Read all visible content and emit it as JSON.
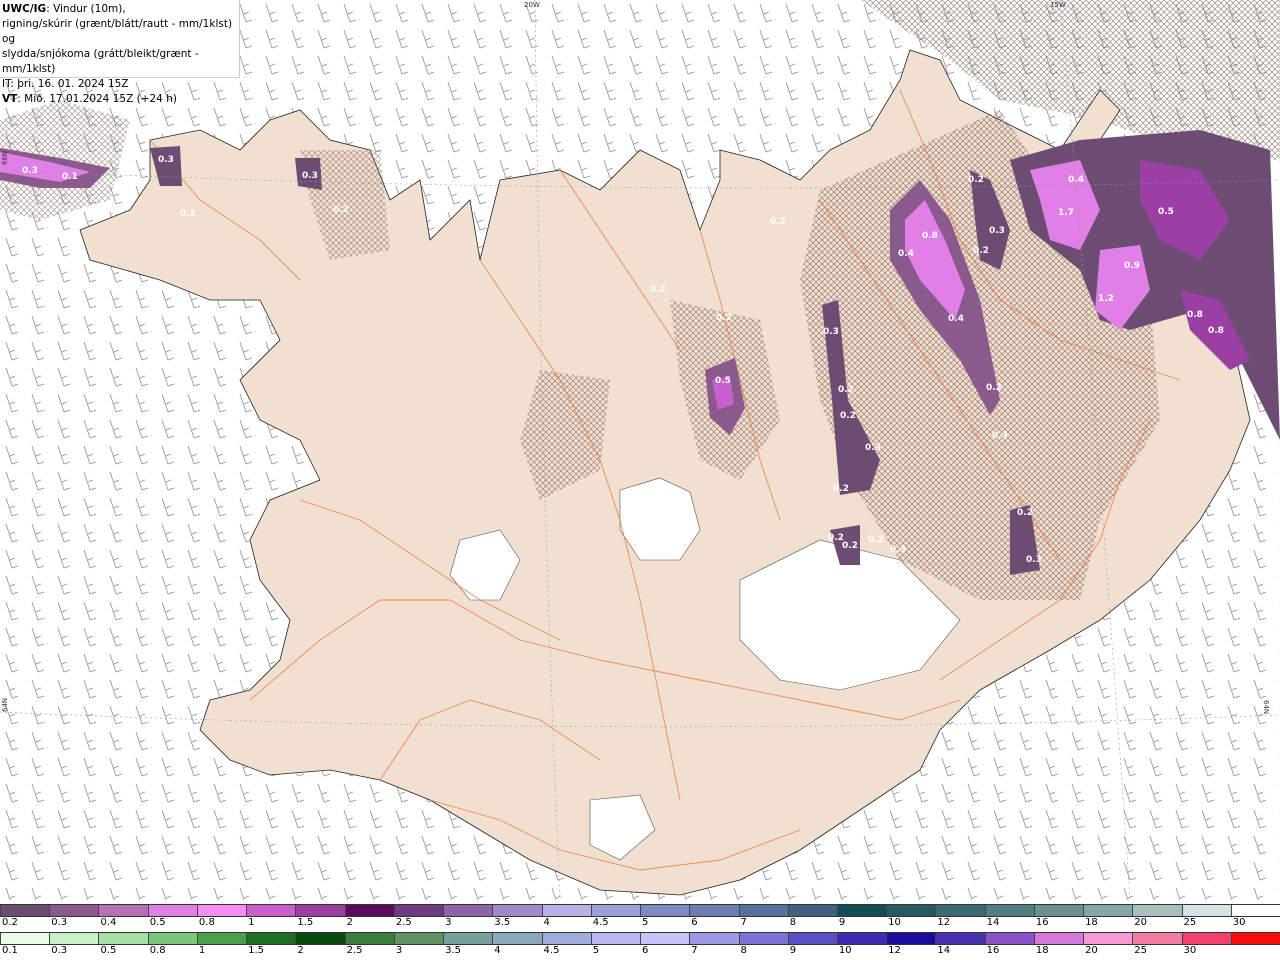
{
  "header": {
    "code": "UWC/IG",
    "line1_rest": ": Vindur (10m),",
    "line2": "rigning/skúrir (grænt/blátt/rautt - mm/1klst) og",
    "line3": "slydda/snjókoma (grátt/bleikt/grænt - mm/1klst)",
    "line4": "IT: þri. 16. 01. 2024 15Z",
    "vt_label": "VT",
    "vt_rest": ": Mið. 17.01.2024 15Z (+24 h)"
  },
  "graticule": {
    "top_left_lon": "20W",
    "top_right_lon": "15W",
    "left_lat_upper": "66N",
    "left_lat_lower": "64N",
    "right_lat_lower": "64N"
  },
  "map_labels": [
    "0.3",
    "0.1",
    "0.3",
    "0.2",
    "0.3",
    "0.2",
    "0.2",
    "0.3",
    "0.3",
    "0.5",
    "0.2",
    "0.2",
    "0.3",
    "0.2",
    "0.2",
    "0.2",
    "0.2",
    "0.8",
    "0.4",
    "0.4",
    "0.2",
    "0.3",
    "0.2",
    "0.2",
    "0.3",
    "0.2",
    "0.3",
    "0.4",
    "1.7",
    "0.5",
    "0.9",
    "1.2",
    "0.8",
    "0.8",
    "0.2",
    "0.3"
  ],
  "snow_scale": {
    "colors": [
      "#6d4c73",
      "#8a5a8d",
      "#b76fb8",
      "#e07fe6",
      "#f58ef4",
      "#c85fcc",
      "#9b3fa4",
      "#5a0b5c",
      "#6e3a80",
      "#8e63a8",
      "#a089c8",
      "#bab0e6",
      "#9aa1d8",
      "#7f8ac4",
      "#6a7cb0",
      "#57709c",
      "#3f6080",
      "#114e56",
      "#275a64",
      "#3a6b72",
      "#4f7e82",
      "#6a9092",
      "#85a6a6",
      "#a9bfbf",
      "#d6e1e1",
      "#ffffff"
    ],
    "labels": [
      "0.2",
      "0.3",
      "0.4",
      "0.5",
      "0.8",
      "1",
      "1.5",
      "2",
      "2.5",
      "3",
      "3.5",
      "4",
      "4.5",
      "5",
      "6",
      "7",
      "8",
      "9",
      "10",
      "12",
      "14",
      "16",
      "18",
      "20",
      "25",
      "30"
    ]
  },
  "rain_scale": {
    "colors": [
      "#e9fbe9",
      "#c9f0c8",
      "#a6e0a4",
      "#7cc67a",
      "#4aa14a",
      "#1e6e23",
      "#0b4a0e",
      "#3b7d3a",
      "#5f9162",
      "#76a19b",
      "#8aa9bd",
      "#a0aede",
      "#b7b8ef",
      "#c6c3f7",
      "#9b98e6",
      "#7a73d6",
      "#5b4fc7",
      "#3d2bb3",
      "#1a0c9c",
      "#4a2fb0",
      "#8a53c8",
      "#d479d7",
      "#f79bd6",
      "#f27ea2",
      "#f2406e",
      "#f80d0d"
    ],
    "labels": [
      "0.1",
      "0.3",
      "0.5",
      "0.8",
      "1",
      "1.5",
      "2",
      "2.5",
      "3",
      "3.5",
      "4",
      "4.5",
      "5",
      "6",
      "7",
      "8",
      "9",
      "10",
      "12",
      "14",
      "16",
      "18",
      "20",
      "25",
      "30"
    ]
  }
}
